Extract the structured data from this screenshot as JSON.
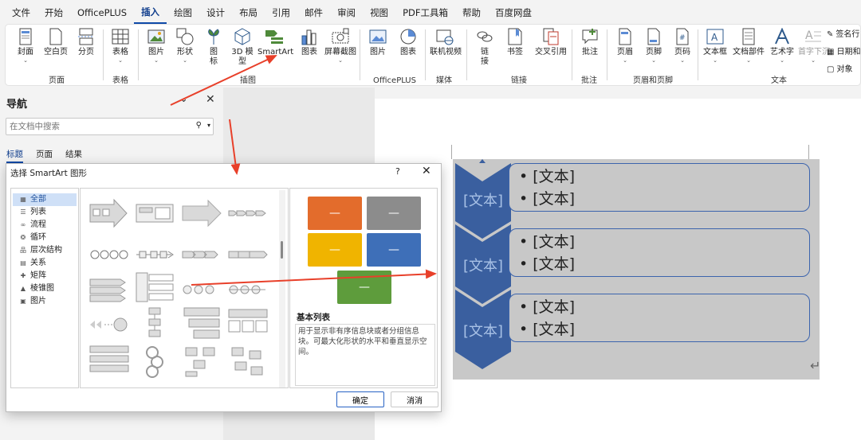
{
  "menu": [
    "文件",
    "开始",
    "OfficePLUS",
    "插入",
    "绘图",
    "设计",
    "布局",
    "引用",
    "邮件",
    "审阅",
    "视图",
    "PDF工具箱",
    "帮助",
    "百度网盘"
  ],
  "active_menu": "插入",
  "ribbon": {
    "groups": {
      "pages": "页面",
      "tables": "表格",
      "illustrations": "插图",
      "officeplus": "OfficePLUS",
      "media": "媒体",
      "links": "链接",
      "comments": "批注",
      "header_footer": "页眉和页脚",
      "text": "文本"
    },
    "buttons": {
      "cover": "封面",
      "blank": "空白页",
      "pagebreak": "分页",
      "table": "表格",
      "picture": "图片",
      "shapes": "形状",
      "icons": "图标",
      "model3d": "3D 模型",
      "smartart": "SmartArt",
      "chart": "图表",
      "screenshot": "屏幕截图",
      "op_picture": "图片",
      "op_chart": "图表",
      "online_video": "联机视频",
      "link": "链接",
      "bookmark": "书签",
      "crossref": "交叉引用",
      "comment": "批注",
      "header": "页眉",
      "footer": "页脚",
      "pagenum": "页码",
      "textbox": "文本框",
      "quickparts": "文档部件",
      "wordart": "艺术字",
      "dropcap": "首字下沉"
    },
    "side": [
      "签名行",
      "日期和",
      "对象"
    ]
  },
  "nav": {
    "title": "导航",
    "search_placeholder": "在文档中搜索",
    "tabs": [
      "标题",
      "页面",
      "结果"
    ]
  },
  "dialog": {
    "title": "选择 SmartArt 图形",
    "help": "?",
    "categories": [
      {
        "label": "全部",
        "icon": "all"
      },
      {
        "label": "列表",
        "icon": "list"
      },
      {
        "label": "流程",
        "icon": "process"
      },
      {
        "label": "循环",
        "icon": "cycle"
      },
      {
        "label": "层次结构",
        "icon": "hierarchy"
      },
      {
        "label": "关系",
        "icon": "relationship"
      },
      {
        "label": "矩阵",
        "icon": "matrix"
      },
      {
        "label": "棱锥图",
        "icon": "pyramid"
      },
      {
        "label": "图片",
        "icon": "picture"
      }
    ],
    "selected_category": "全部",
    "preview_name": "基本列表",
    "preview_desc": "用于显示非有序信息块或者分组信息块。可最大化形状的水平和垂直显示空间。",
    "preview_colors": [
      "#e36c2c",
      "#8c8c8c",
      "#f0b400",
      "#3e6fb8",
      "#5e9c3c"
    ],
    "preview_dash": "—",
    "ok": "确定",
    "cancel": "消消"
  },
  "smartart": {
    "rows": [
      {
        "label": "[文本]",
        "bullets": [
          "[文本]",
          "[文本]"
        ]
      },
      {
        "label": "[文本]",
        "bullets": [
          "[文本]",
          "[文本]"
        ]
      },
      {
        "label": "[文本]",
        "bullets": [
          "[文本]",
          "[文本]"
        ]
      }
    ],
    "chevron_color": "#3a5f9f",
    "border_color": "#3c64ad",
    "bg_color": "#c8c8c8"
  },
  "accent_arrow_color": "#e8402a"
}
